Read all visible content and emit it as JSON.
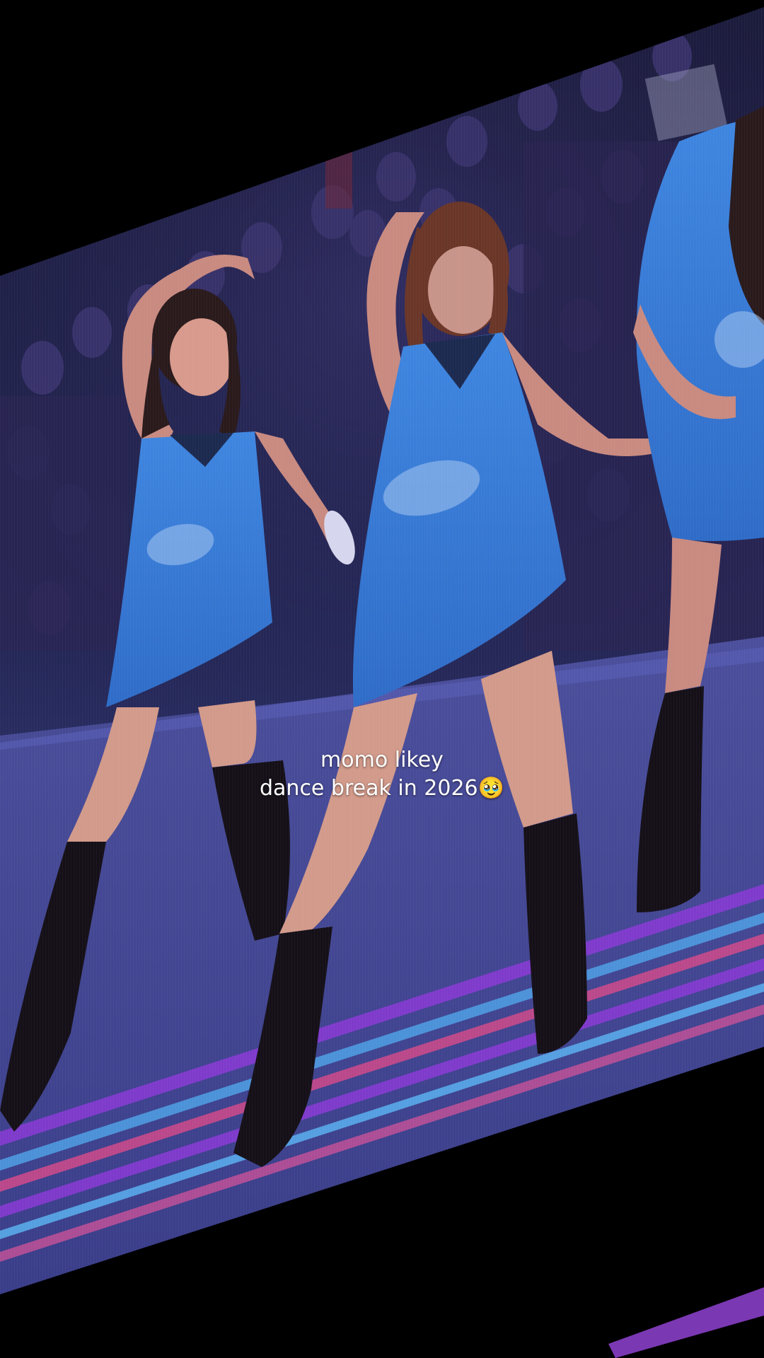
{
  "caption": {
    "line1": "momo likey",
    "line2": "dance break in 2026🥹"
  },
  "scene": {
    "icons": [
      "crowd-silhouettes",
      "stage-light-stripes"
    ],
    "colors": {
      "background": "#000000",
      "screen_glow": "#2a2f6b",
      "outfit_blue": "#3a7fd8",
      "stage_purple": "#8a3ad6",
      "stage_pink": "#d04a8a"
    }
  }
}
